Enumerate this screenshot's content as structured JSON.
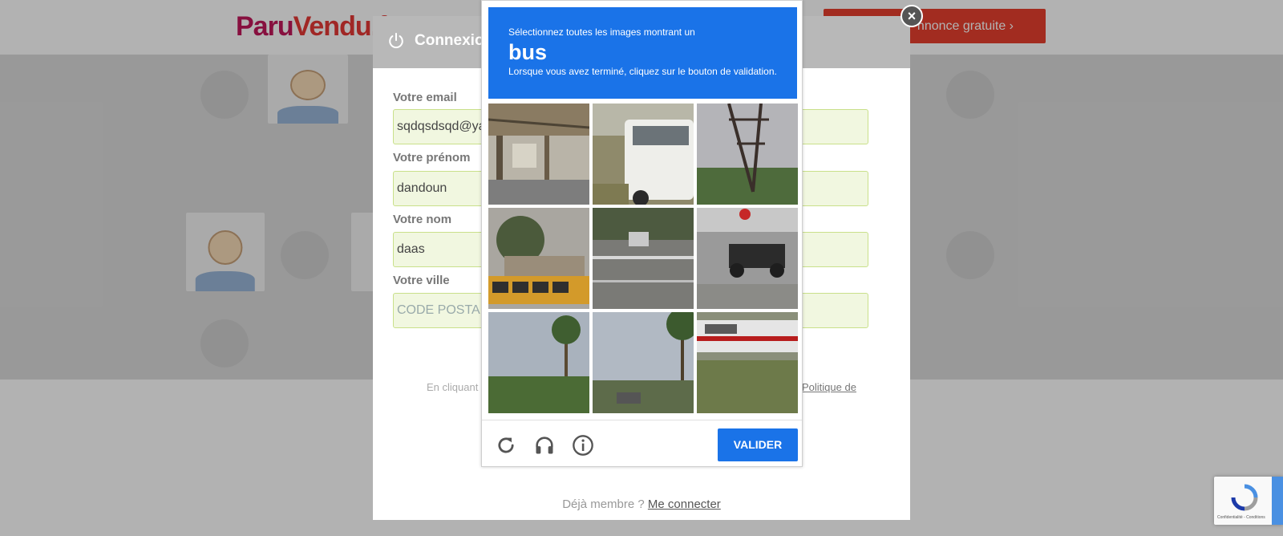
{
  "site": {
    "logo_part1": "Paru",
    "logo_part2": "Vendu.f",
    "cta_label": "nnonce gratuite ›"
  },
  "signup_modal": {
    "title": "Connexio",
    "fields": [
      {
        "label": "Votre email",
        "value": "sqdqsdsqd@ya",
        "placeholder": ""
      },
      {
        "label": "Votre prénom",
        "value": "dandoun",
        "placeholder": ""
      },
      {
        "label": "Votre nom",
        "value": "daas",
        "placeholder": ""
      },
      {
        "label": "Votre ville",
        "value": "",
        "placeholder": "CODE POSTAL"
      }
    ],
    "legal_left": "En cliquant",
    "legal_right": "Politique de",
    "member_text": "Déjà membre ? ",
    "member_link": "Me connecter"
  },
  "captcha": {
    "instruction": "Sélectionnez toutes les images montrant un",
    "target": "bus",
    "subtext": "Lorsque vous avez terminé, cliquez sur le bouton de validation.",
    "validate_label": "VALIDER",
    "icons": [
      "reload-icon",
      "audio-icon",
      "info-icon"
    ],
    "tiles": [
      {
        "name": "tile-1",
        "scene": "station-interior"
      },
      {
        "name": "tile-2",
        "scene": "white-bus"
      },
      {
        "name": "tile-3",
        "scene": "pylon-hill"
      },
      {
        "name": "tile-4",
        "scene": "yellow-bus"
      },
      {
        "name": "tile-5",
        "scene": "parking-lot"
      },
      {
        "name": "tile-6",
        "scene": "motorcycles"
      },
      {
        "name": "tile-7",
        "scene": "palm-trees"
      },
      {
        "name": "tile-8",
        "scene": "street-palms"
      },
      {
        "name": "tile-9",
        "scene": "vehicle-grass"
      }
    ]
  },
  "recaptcha": {
    "terms": "Confidentialité - Conditions"
  },
  "colors": {
    "captcha_blue": "#1a73e8",
    "field_bg": "#f1f7e0",
    "header_gray": "#b8b8b8"
  }
}
